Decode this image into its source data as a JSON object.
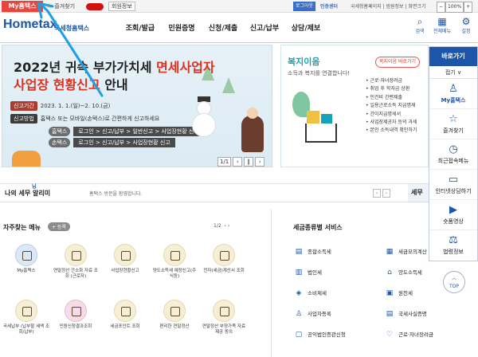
{
  "topbar": {
    "my_hometax": "My홈택스",
    "favorites": "즐겨찾기",
    "user_info": "회원정보",
    "logout": "로그아웃",
    "cert_center": "인증센터",
    "links": "국세청홈페이지 | 범원정보 | 화면크기",
    "zoom_minus": "−",
    "zoom_value": "100%",
    "zoom_plus": "+"
  },
  "header": {
    "logo": "Hometax",
    "logo_sub": "국세청홈택스",
    "nav": [
      "조회/발급",
      "민원증명",
      "신청/제출",
      "신고/납부",
      "상담/제보"
    ],
    "search": "검색",
    "all_menu": "전체메뉴",
    "settings": "설정"
  },
  "banner": {
    "title1_a": "2022년 귀속 부가가치세 ",
    "title1_b": "면세사업자",
    "title2_a": "사업장 현황신고",
    "title2_b": " 안내",
    "period_tag": "신고기간",
    "period_text": "2023. 1. 1.(일)~2. 10.(금)",
    "method_tag": "신고방법",
    "method_text": "홈택스 또는 모바일(손택스)로 간편하게 신고하세요",
    "hometax_label": "홈택스",
    "hometax_path": "로그인 > 신고/납부 > 일반신고 > 사업장현황 신고",
    "sontax_label": "손택스",
    "sontax_path": "로그인 > 신고/납부 > 사업장현황 신고",
    "pager_index": "1/1",
    "pager_prev": "‹",
    "pager_pause": "‖",
    "pager_next": "›"
  },
  "welfare": {
    "title": "복지이음",
    "subtitle": "소득과 복지를 연결합니다!",
    "button": "복지이음 바로가기",
    "items": [
      "근로·자녀장려금",
      "취업 후 학자금 상환",
      "인건비 간편제출",
      "일용근로소득 지급명세",
      "간이지급명세서",
      "사업장제공자 등의 과세",
      "본인 소득내역 확인하기"
    ]
  },
  "quick": {
    "title": "바로가기",
    "fold": "접기 ∨",
    "items": [
      {
        "icon": "person-icon",
        "glyph": "♙",
        "label": "My홈택스"
      },
      {
        "icon": "star-icon",
        "glyph": "☆",
        "label": "즐겨찾기"
      },
      {
        "icon": "clock-icon",
        "glyph": "◷",
        "label": "최근접속메뉴"
      },
      {
        "icon": "laptop-icon",
        "glyph": "▭",
        "label": "인터넷상담하기"
      },
      {
        "icon": "play-icon",
        "glyph": "▶",
        "label": "숏폼영상"
      },
      {
        "icon": "gavel-icon",
        "glyph": "⚖",
        "label": "법령정보"
      }
    ],
    "top": "TOP"
  },
  "notice": {
    "title": "나의 세무 알리미",
    "title_small": "님",
    "message": "홈택스 방문을 환영합니다.",
    "sebu": "세무"
  },
  "frequent": {
    "title": "자주찾는 메뉴",
    "register": "+ 등록",
    "page": "1/2",
    "tiles": [
      {
        "label": "My홈택스",
        "style": "blue"
      },
      {
        "label": "연말정산 간소화 자료 조회 (근로자)",
        "style": "beige"
      },
      {
        "label": "사업장현황신고",
        "style": "beige"
      },
      {
        "label": "양도소득세 예정신고(주식등)",
        "style": "beige"
      },
      {
        "label": "전자(세금)계산서 조회",
        "style": "beige"
      },
      {
        "label": "국세납부 (납부할 세액 조회/납부)",
        "style": "beige"
      },
      {
        "label": "민원신청결과조회",
        "style": "pink"
      },
      {
        "label": "세금포인트 조회",
        "style": "beige"
      },
      {
        "label": "편리한 연말정산",
        "style": "beige"
      },
      {
        "label": "연말정산 부양가족 자료제공 동의",
        "style": "beige"
      }
    ]
  },
  "tax_services": {
    "title": "세금종류별 서비스",
    "items": [
      {
        "label": "종합소득세",
        "glyph": "▤"
      },
      {
        "label": "세금모의계산",
        "glyph": "▦"
      },
      {
        "label": "법인세",
        "glyph": "▥"
      },
      {
        "label": "양도소득세",
        "glyph": "⌂"
      },
      {
        "label": "소비제세",
        "glyph": "◈"
      },
      {
        "label": "원천세",
        "glyph": "▣"
      },
      {
        "label": "사업자등록",
        "glyph": "♙"
      },
      {
        "label": "국세사실증명",
        "glyph": "▤"
      },
      {
        "label": "공익법인증관신청",
        "glyph": "▢"
      },
      {
        "label": "근로·자녀장려금",
        "glyph": "♡"
      }
    ]
  }
}
